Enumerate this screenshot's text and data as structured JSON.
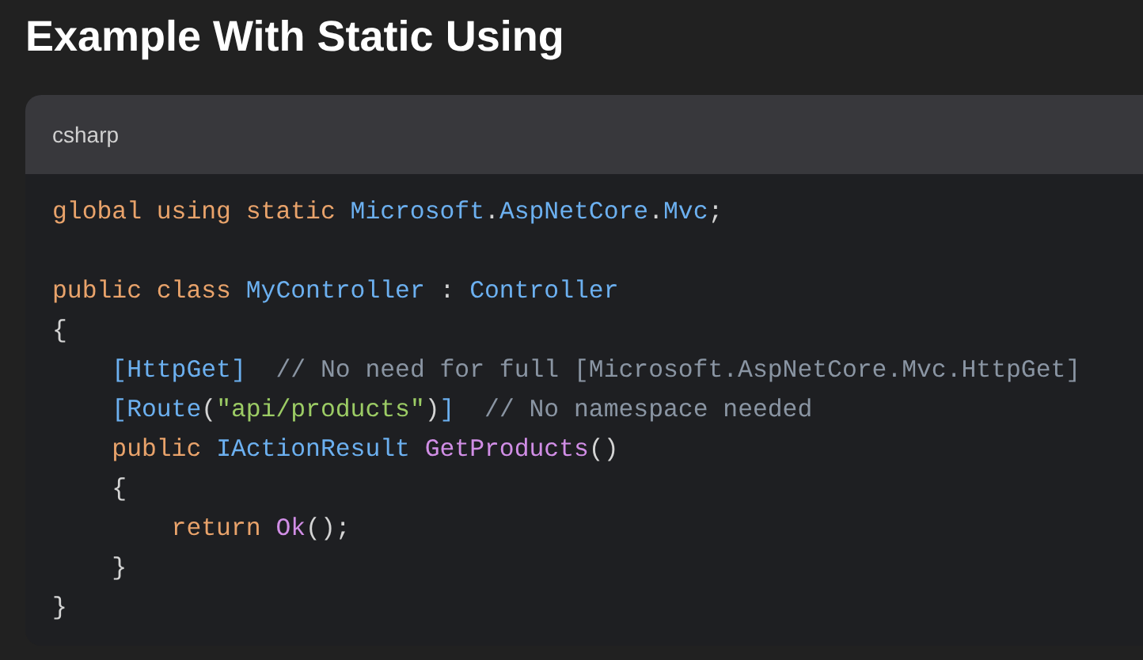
{
  "title": "Example With Static Using",
  "code_block": {
    "language": "csharp",
    "lines": [
      {
        "kind": "code",
        "tokens": [
          {
            "kind": "keyword",
            "text": "global using static "
          },
          {
            "kind": "type",
            "text": "Microsoft"
          },
          {
            "kind": "plain",
            "text": "."
          },
          {
            "kind": "type",
            "text": "AspNetCore"
          },
          {
            "kind": "plain",
            "text": "."
          },
          {
            "kind": "type",
            "text": "Mvc"
          },
          {
            "kind": "plain",
            "text": ";"
          }
        ]
      },
      {
        "kind": "blank"
      },
      {
        "kind": "code",
        "tokens": [
          {
            "kind": "keyword",
            "text": "public class "
          },
          {
            "kind": "type",
            "text": "MyController"
          },
          {
            "kind": "plain",
            "text": " : "
          },
          {
            "kind": "type",
            "text": "Controller"
          }
        ]
      },
      {
        "kind": "code",
        "tokens": [
          {
            "kind": "plain",
            "text": "{"
          }
        ]
      },
      {
        "kind": "code",
        "tokens": [
          {
            "kind": "type",
            "text": "    [HttpGet]"
          },
          {
            "kind": "comment",
            "text": "  // No need for full [Microsoft.AspNetCore.Mvc.HttpGet]"
          }
        ]
      },
      {
        "kind": "code",
        "tokens": [
          {
            "kind": "type",
            "text": "    [Route"
          },
          {
            "kind": "plain",
            "text": "("
          },
          {
            "kind": "string",
            "text": "\"api/products\""
          },
          {
            "kind": "plain",
            "text": ")"
          },
          {
            "kind": "type",
            "text": "]"
          },
          {
            "kind": "comment",
            "text": "  // No namespace needed"
          }
        ]
      },
      {
        "kind": "code",
        "tokens": [
          {
            "kind": "keyword",
            "text": "    public "
          },
          {
            "kind": "type",
            "text": "IActionResult "
          },
          {
            "kind": "function",
            "text": "GetProducts"
          },
          {
            "kind": "plain",
            "text": "()"
          }
        ]
      },
      {
        "kind": "code",
        "tokens": [
          {
            "kind": "plain",
            "text": "    {"
          }
        ]
      },
      {
        "kind": "code",
        "tokens": [
          {
            "kind": "keyword",
            "text": "        return "
          },
          {
            "kind": "function",
            "text": "Ok"
          },
          {
            "kind": "plain",
            "text": "();"
          }
        ]
      },
      {
        "kind": "code",
        "tokens": [
          {
            "kind": "plain",
            "text": "    }"
          }
        ]
      },
      {
        "kind": "code",
        "tokens": [
          {
            "kind": "plain",
            "text": "}"
          }
        ]
      }
    ]
  }
}
